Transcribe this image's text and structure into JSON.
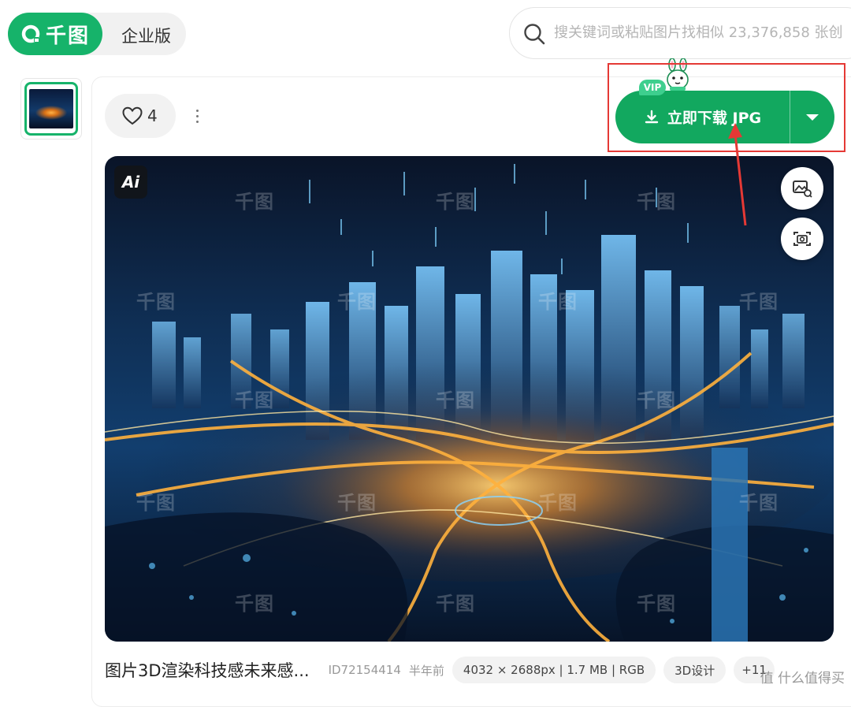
{
  "header": {
    "logo_text": "千图",
    "enterprise_label": "企业版",
    "search_placeholder": "搜关键词或粘贴图片找相似 23,376,858 张创"
  },
  "detail": {
    "like_count": "4",
    "vip_label": "VIP",
    "download_label": "立即下载 JPG",
    "ai_badge": "Ai",
    "watermark": "千图"
  },
  "info": {
    "title": "图片3D渲染科技感未来感...",
    "id": "ID72154414",
    "age": "半年前",
    "specs": "4032 × 2688px | 1.7 MB | RGB",
    "tag": "3D设计",
    "more_tags": "+11"
  },
  "footer_watermark": "值 什么值得买",
  "colors": {
    "brand_green": "#16b36a",
    "download_green": "#12a85f",
    "annotation_red": "#e53935"
  },
  "icons": [
    "search-icon",
    "heart-icon",
    "more-icon",
    "download-icon",
    "chevron-down-icon",
    "image-search-icon",
    "camera-icon",
    "ai-icon"
  ]
}
